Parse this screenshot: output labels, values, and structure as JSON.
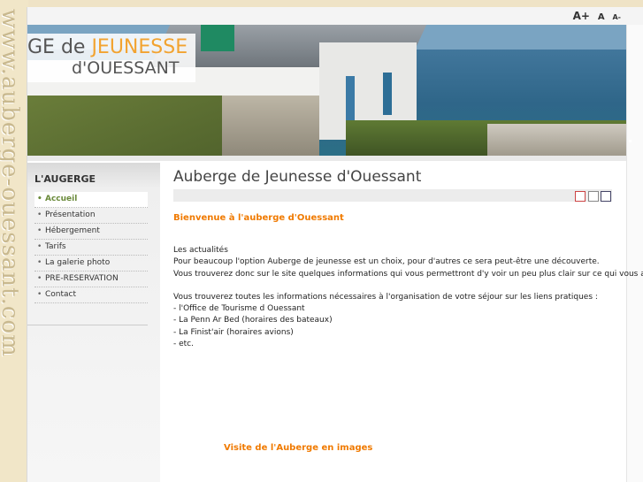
{
  "side_url": "www.auberge-ouessant.com",
  "font_controls": {
    "increase": "A+",
    "reset": "A",
    "decrease": "A-"
  },
  "header": {
    "title_line1_prefix": "GE de ",
    "title_line1_highlight": "JEUNESSE",
    "title_line2": "d'OUESSANT"
  },
  "sidebar": {
    "heading": "L'AUGERGE",
    "items": [
      {
        "label": "Accueil",
        "active": true
      },
      {
        "label": "Présentation"
      },
      {
        "label": "Hébergement"
      },
      {
        "label": "Tarifs"
      },
      {
        "label": "La galerie photo"
      },
      {
        "label": "PRE-RESERVATION"
      },
      {
        "label": "Contact"
      }
    ]
  },
  "main": {
    "page_title": "Auberge de Jeunesse d'Ouessant",
    "tool_icons": [
      "pdf-icon",
      "print-icon",
      "email-icon"
    ],
    "welcome": "Bienvenue à l'auberge d'Ouessant",
    "paragraph1": [
      "Les actualités",
      "Pour beaucoup l'option Auberge de jeunesse est un choix, pour d'autres ce sera  peut-être une découverte.",
      "Vous trouverez donc sur le site quelques informations qui vous permettront d'y voir un peu plus clair sur ce qui vous attend."
    ],
    "paragraph2": [
      "Vous trouverez toutes les informations nécessaires à l'organisation de votre séjour sur les liens pratiques :",
      "- l'Office de Tourisme d Ouessant",
      "- La Penn Ar Bed (horaires des bateaux)",
      "- La Finist'air (horaires avions)",
      "- etc."
    ],
    "gallery_link": "Visite de l'Auberge en images"
  },
  "colors": {
    "accent": "#f07a00",
    "active_menu": "#6a8a3a",
    "title_highlight": "#f2a330"
  }
}
